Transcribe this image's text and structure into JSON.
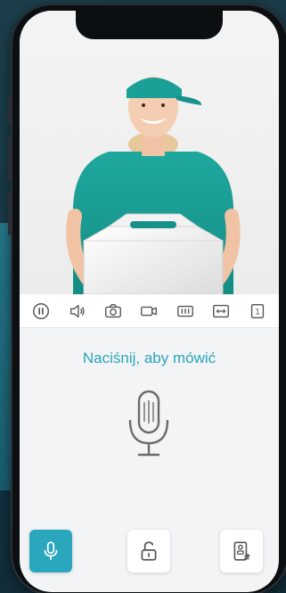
{
  "prompt": {
    "label": "Naciśnij, aby mówić"
  },
  "toolbar": {
    "items": [
      {
        "icon": "pause-icon"
      },
      {
        "icon": "speaker-icon"
      },
      {
        "icon": "camera-icon"
      },
      {
        "icon": "video-record-icon"
      },
      {
        "icon": "film-icon"
      },
      {
        "icon": "expand-horizontal-icon"
      },
      {
        "icon": "channel-number-icon",
        "label": "1"
      }
    ]
  },
  "bottom": {
    "items": [
      {
        "icon": "microphone-icon",
        "active": true
      },
      {
        "icon": "unlock-icon",
        "active": false
      },
      {
        "icon": "intercom-switch-icon",
        "active": false
      }
    ]
  },
  "colors": {
    "accent": "#2aa6bd",
    "shirt": "#1a9e95"
  }
}
